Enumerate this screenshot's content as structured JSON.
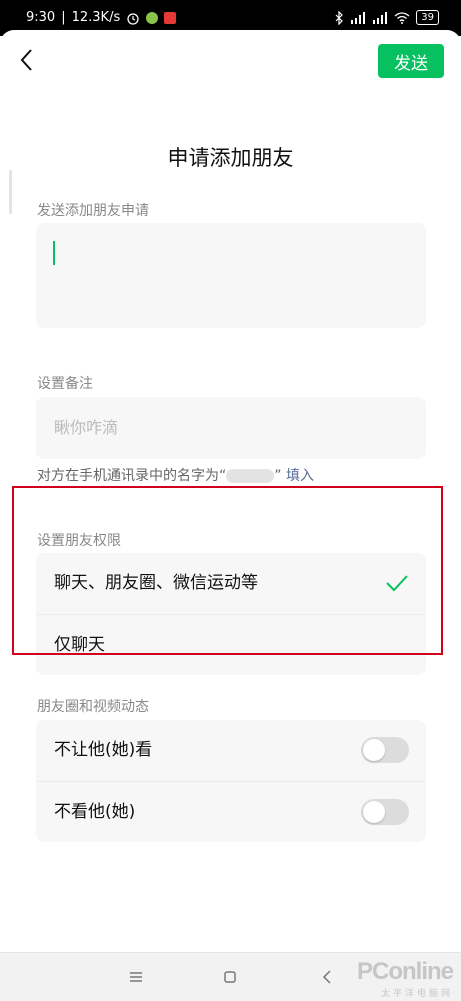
{
  "status_bar": {
    "time": "9:30",
    "net_speed": "12.3K/s",
    "battery": "39"
  },
  "header": {
    "back_icon": "chevron-left-icon",
    "send_label": "发送",
    "accent_color": "#07c160"
  },
  "page_title": "申请添加朋友",
  "request_section": {
    "label": "发送添加朋友申请",
    "value": ""
  },
  "remark_section": {
    "label": "设置备注",
    "placeholder": "瞅你咋滴",
    "hint_prefix": "对方在手机通讯录中的名字为“",
    "hint_suffix": "”",
    "fill_link": "填入"
  },
  "permission_section": {
    "label": "设置朋友权限",
    "options": [
      {
        "label": "聊天、朋友圈、微信运动等",
        "selected": true
      },
      {
        "label": "仅聊天",
        "selected": false
      }
    ]
  },
  "moments_section": {
    "label": "朋友圈和视频动态",
    "toggles": [
      {
        "label": "不让他(她)看",
        "on": false
      },
      {
        "label": "不看他(她)",
        "on": false
      }
    ]
  },
  "watermark": {
    "brand": "PConline",
    "sub": "太平洋电脑网"
  }
}
